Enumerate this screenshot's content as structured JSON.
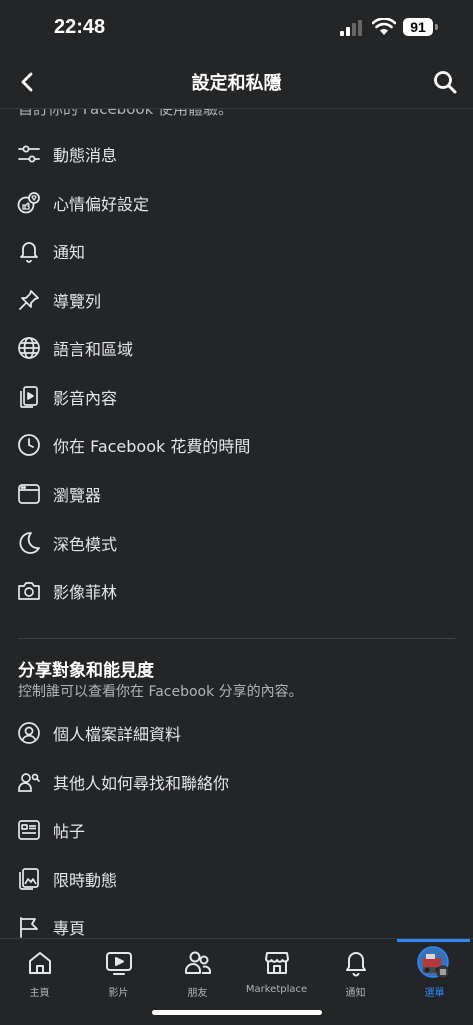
{
  "status_bar": {
    "time": "22:48",
    "battery": "91"
  },
  "header": {
    "title": "設定和私隱",
    "back_icon": "chevron-left-icon",
    "search_icon": "search-icon"
  },
  "content": {
    "cut_off_text": "自訂你的 Facebook 使用體驗。",
    "preferences": [
      {
        "label": "動態消息",
        "icon": "sliders-icon"
      },
      {
        "label": "心情偏好設定",
        "icon": "reactions-icon"
      },
      {
        "label": "通知",
        "icon": "bell-icon"
      },
      {
        "label": "導覽列",
        "icon": "pin-icon"
      },
      {
        "label": "語言和區域",
        "icon": "globe-icon"
      },
      {
        "label": "影音內容",
        "icon": "media-icon"
      },
      {
        "label": "你在 Facebook 花費的時間",
        "icon": "clock-icon"
      },
      {
        "label": "瀏覽器",
        "icon": "browser-icon"
      },
      {
        "label": "深色模式",
        "icon": "moon-icon"
      },
      {
        "label": "影像菲林",
        "icon": "camera-icon"
      }
    ],
    "audience_section": {
      "title": "分享對象和能見度",
      "subtitle": "控制誰可以查看你在 Facebook 分享的內容。",
      "items": [
        {
          "label": "個人檔案詳細資料",
          "icon": "user-circle-icon"
        },
        {
          "label": "其他人如何尋找和聯絡你",
          "icon": "user-search-icon"
        },
        {
          "label": "帖子",
          "icon": "posts-icon"
        },
        {
          "label": "限時動態",
          "icon": "stories-icon"
        },
        {
          "label": "專頁",
          "icon": "flag-icon"
        }
      ]
    }
  },
  "tab_bar": {
    "tabs": [
      {
        "label": "主頁",
        "icon": "home-icon",
        "active": false
      },
      {
        "label": "影片",
        "icon": "video-icon",
        "active": false
      },
      {
        "label": "朋友",
        "icon": "friends-icon",
        "active": false
      },
      {
        "label": "Marketplace",
        "icon": "marketplace-icon",
        "active": false
      },
      {
        "label": "通知",
        "icon": "bell-icon",
        "active": false
      },
      {
        "label": "選單",
        "icon": "avatar-menu-icon",
        "active": true
      }
    ]
  },
  "colors": {
    "background": "#242526",
    "text": "#e4e6eb",
    "muted": "#b0b3b8",
    "accent": "#2d88ff"
  }
}
